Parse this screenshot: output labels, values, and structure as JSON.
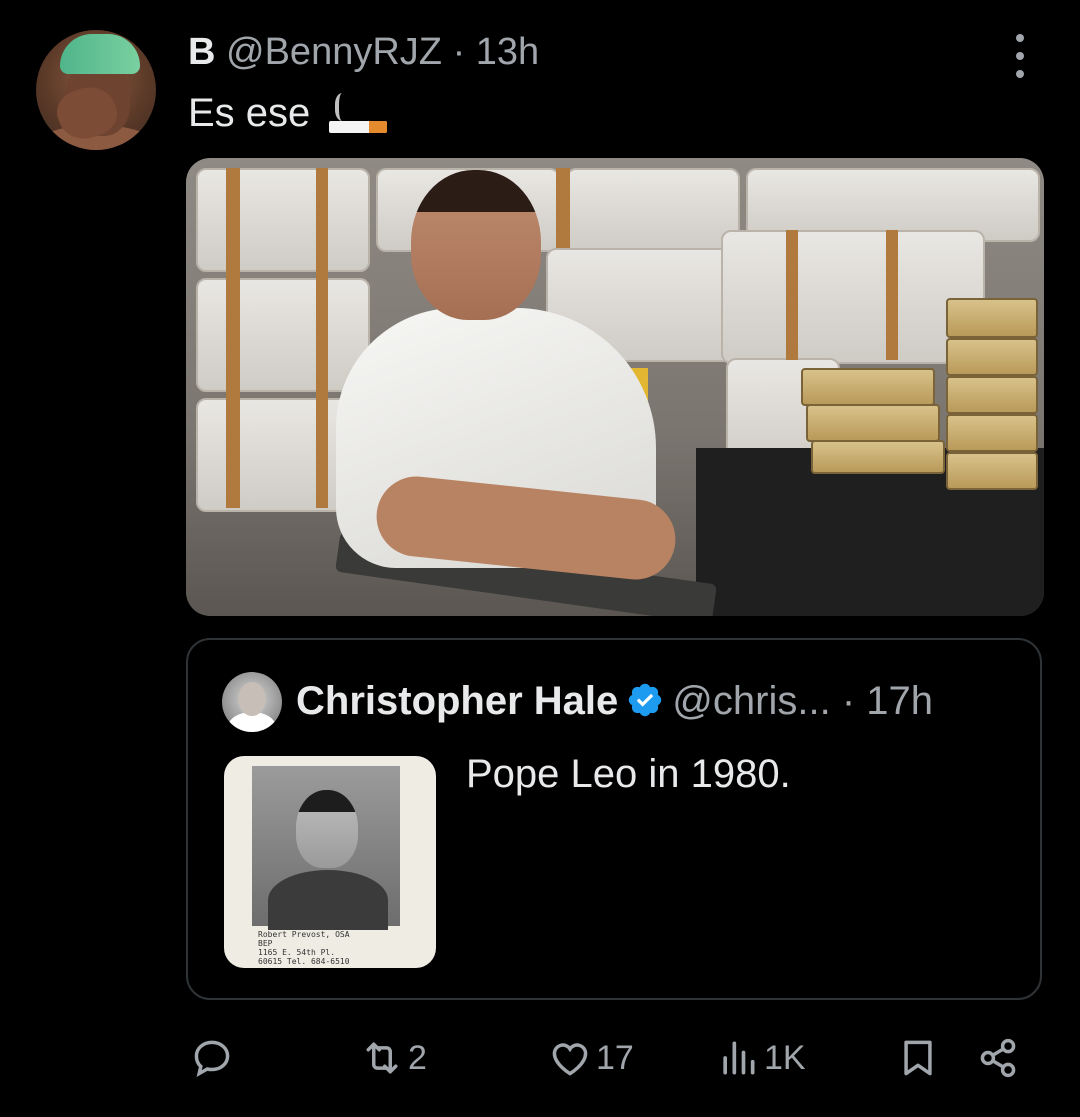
{
  "tweet": {
    "display_name": "B",
    "handle": "@BennyRJZ",
    "separator": "·",
    "time": "13h",
    "text": "Es ese"
  },
  "quote": {
    "display_name": "Christopher Hale",
    "handle": "@chris...",
    "separator": "·",
    "time": "17h",
    "text": "Pope Leo in 1980.",
    "image_caption": "Robert Prevost, OSA\nBEP\n1165 E. 54th Pl.\n60615 Tel. 684-6510"
  },
  "actions": {
    "reply_count": "",
    "retweet_count": "2",
    "like_count": "17",
    "view_count": "1K"
  },
  "icons": {
    "more": "more-icon",
    "verified": "verified-badge-icon",
    "reply": "reply-icon",
    "retweet": "retweet-icon",
    "like": "heart-icon",
    "views": "views-icon",
    "bookmark": "bookmark-icon",
    "share": "share-icon"
  },
  "colors": {
    "background": "#000000",
    "text_primary": "#e7e9ea",
    "text_secondary": "#a0a6ab",
    "verified": "#1d9bf0",
    "border": "#2f3336"
  }
}
